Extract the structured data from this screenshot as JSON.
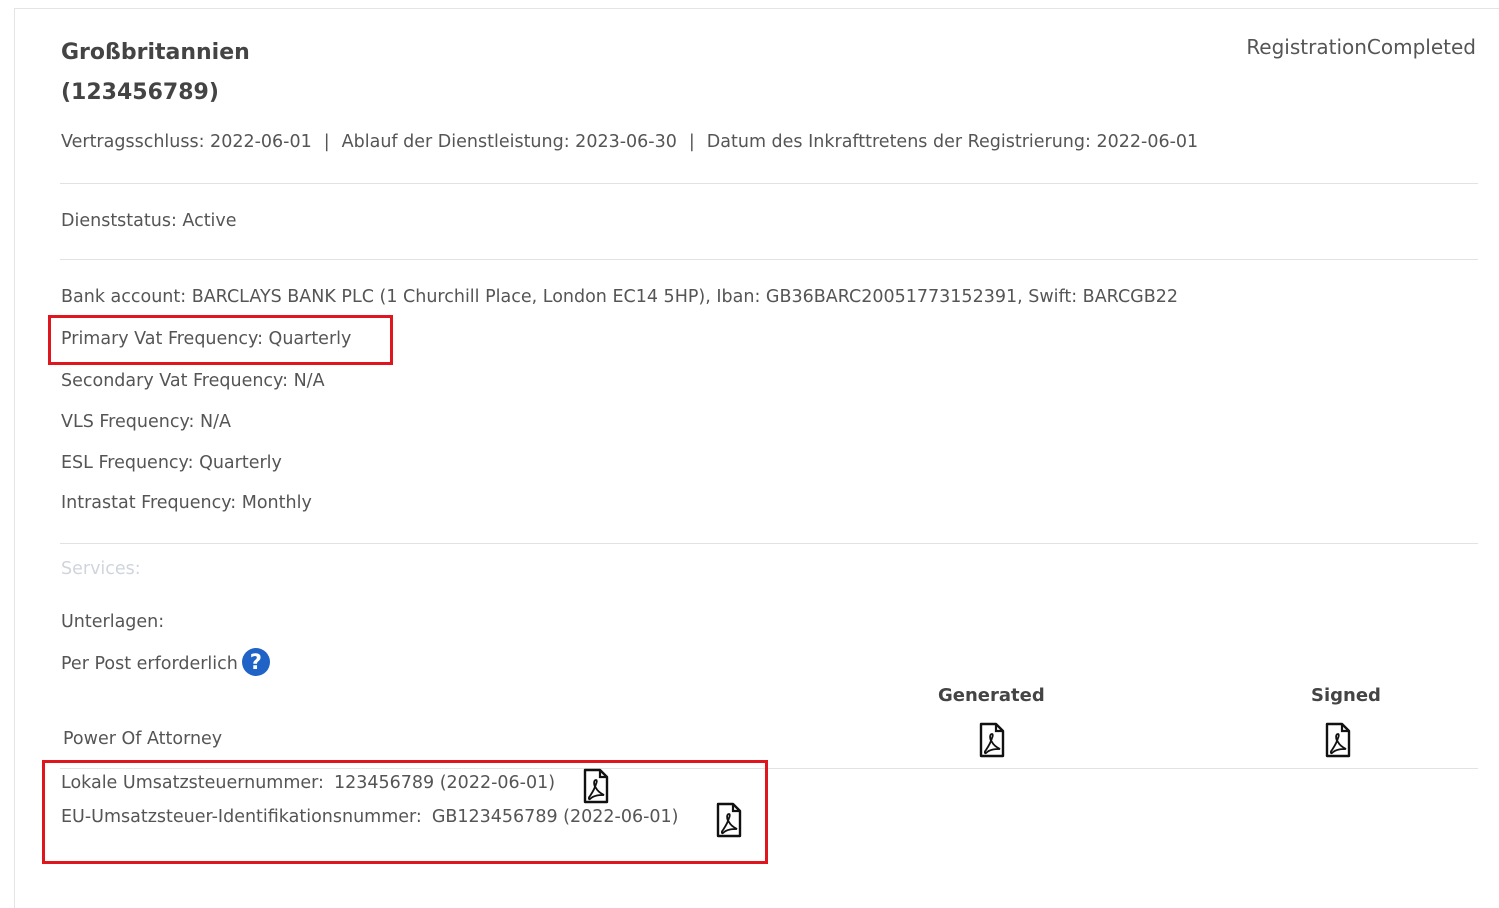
{
  "header": {
    "title_line1": "Großbritannien",
    "title_line2": "(123456789)",
    "status": "RegistrationCompleted"
  },
  "meta": {
    "contract": "Vertragsschluss: 2022-06-01",
    "expiry": "Ablauf der Dienstleistung: 2023-06-30",
    "effective": "Datum des Inkrafttretens der Registrierung: 2022-06-01",
    "separator": "|"
  },
  "service_status": "Dienststatus: Active",
  "details": {
    "bank_account": "Bank account: BARCLAYS BANK PLC (1 Churchill Place, London EC14 5HP), Iban: GB36BARC20051773152391, Swift: BARCGB22",
    "primary_vat": "Primary Vat Frequency: Quarterly",
    "secondary_vat": "Secondary Vat Frequency: N/A",
    "vls": "VLS Frequency: N/A",
    "esl": "ESL Frequency: Quarterly",
    "intrastat": "Intrastat Frequency: Monthly"
  },
  "services_label": "Services:",
  "documents": {
    "label": "Unterlagen:",
    "post_required": "Per Post erforderlich",
    "help_glyph": "?",
    "col_generated": "Generated",
    "col_signed": "Signed",
    "row_label": "Power Of Attorney"
  },
  "tax_numbers": {
    "local_label": "Lokale Umsatzsteuernummer:",
    "local_value": "123456789 (2022-06-01)",
    "eu_label": "EU-Umsatzsteuer-Identifikationsnummer:",
    "eu_value": "GB123456789 (2022-06-01)"
  },
  "icons": {
    "pdf": "pdf-file-icon",
    "help": "question-circle-icon"
  },
  "colors": {
    "highlight": "#e0161e",
    "help_icon": "#1f63c6",
    "muted_text": "#cfd5dc"
  }
}
